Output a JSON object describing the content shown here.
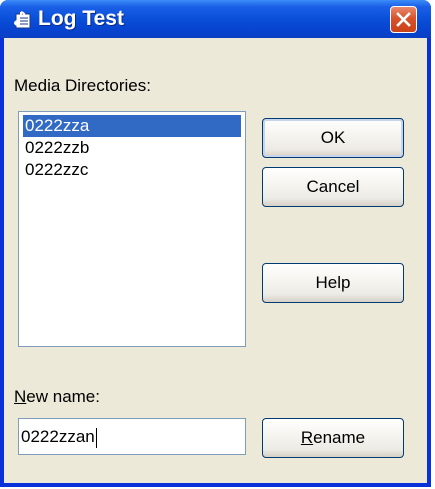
{
  "window": {
    "title": "Log Test",
    "app_icon": "music-note-icon",
    "close_icon": "close-x-icon"
  },
  "media": {
    "label": "Media Directories:",
    "items": [
      "0222zza",
      "0222zzb",
      "0222zzc"
    ],
    "selected_index": 0
  },
  "buttons": {
    "ok": "OK",
    "cancel": "Cancel",
    "help": "Help",
    "rename_mnemonic": "R",
    "rename_rest": "ename"
  },
  "new_name": {
    "label_mnemonic": "N",
    "label_rest": "ew name:",
    "value": "0222zzan"
  },
  "colors": {
    "title_bar": "#0a4fd9",
    "selection": "#316ac5",
    "close_button": "#d8522c",
    "dialog_face": "#ece9d8"
  }
}
